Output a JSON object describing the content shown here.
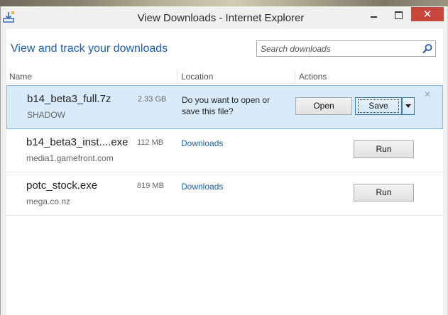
{
  "window": {
    "title": "View Downloads - Internet Explorer",
    "close_symbol": "✕"
  },
  "header": {
    "heading": "View and track your downloads",
    "search_placeholder": "Search downloads"
  },
  "columns": {
    "name": "Name",
    "location": "Location",
    "actions": "Actions"
  },
  "downloads": [
    {
      "name": "b14_beta3_full.7z",
      "size": "2.33 GB",
      "source": "SHADOW",
      "prompt": "Do you want to open or save this file?",
      "open_label": "Open",
      "save_label": "Save",
      "dismiss": "✕"
    },
    {
      "name": "b14_beta3_inst....exe",
      "size": "112 MB",
      "source": "media1.gamefront.com",
      "location": "Downloads",
      "run_label": "Run"
    },
    {
      "name": "potc_stock.exe",
      "size": "819 MB",
      "source": "mega.co.nz",
      "location": "Downloads",
      "run_label": "Run"
    }
  ],
  "icons": {
    "app": "download-arrow-icon",
    "search": "magnifier-icon"
  },
  "colors": {
    "accent": "#1e5fa8",
    "selection": "#d9ebf9",
    "close": "#c9463d"
  }
}
